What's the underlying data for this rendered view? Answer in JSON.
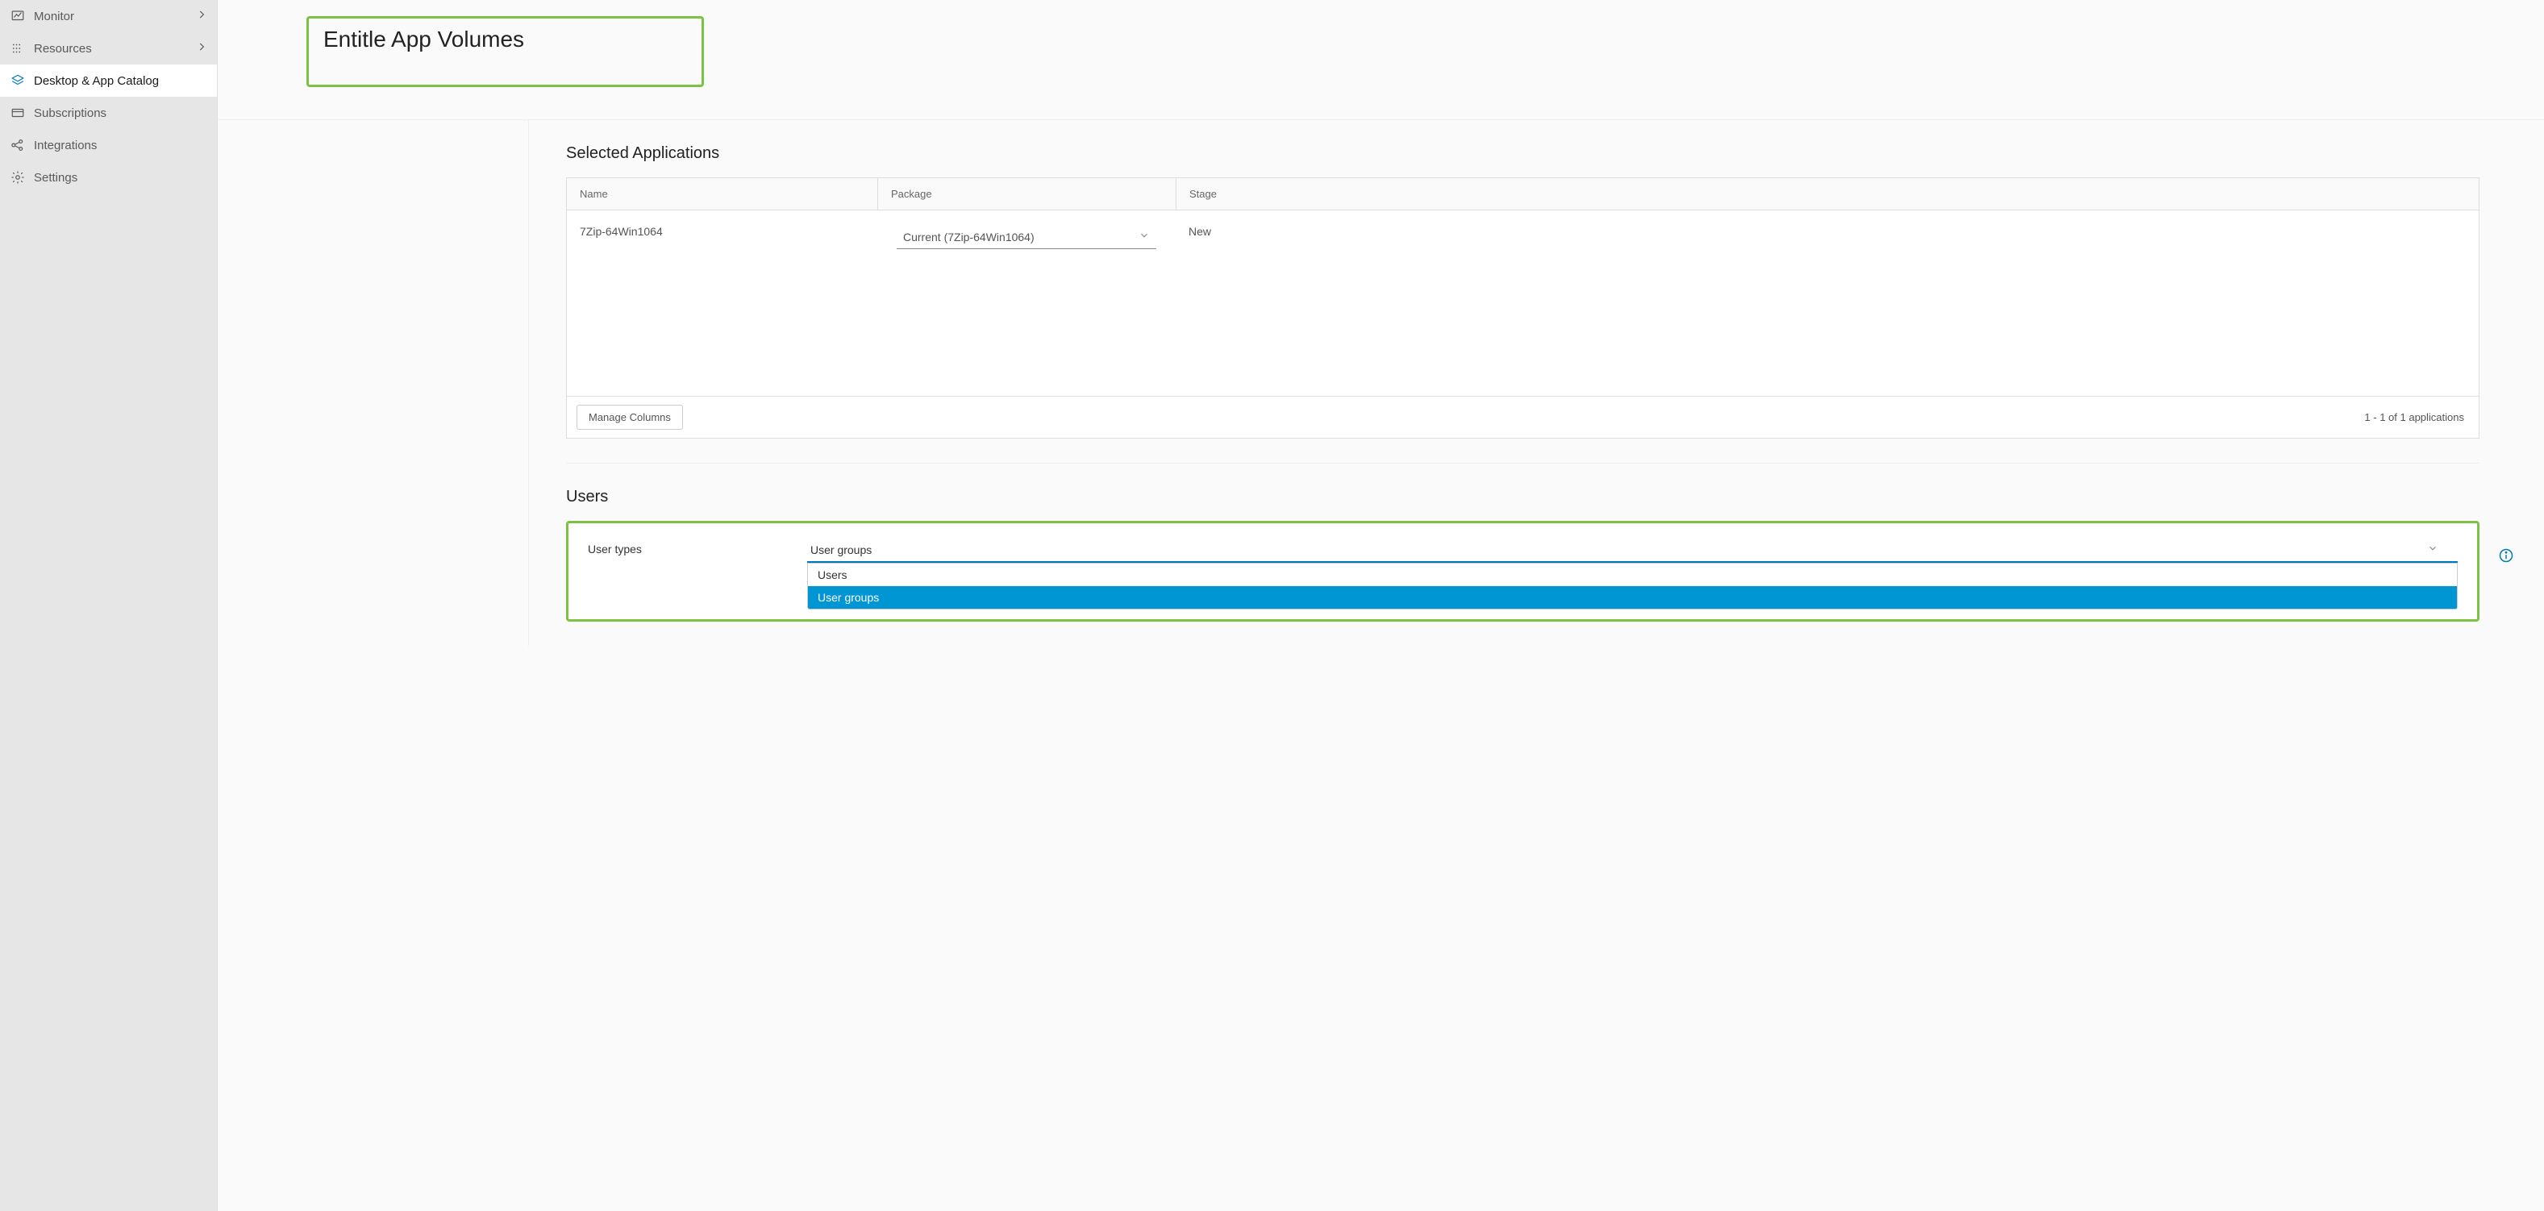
{
  "sidebar": {
    "items": [
      {
        "label": "Monitor",
        "icon": "chart-icon",
        "expandable": true
      },
      {
        "label": "Resources",
        "icon": "grid-icon",
        "expandable": true
      },
      {
        "label": "Desktop & App Catalog",
        "icon": "stack-icon",
        "active": true
      },
      {
        "label": "Subscriptions",
        "icon": "card-icon"
      },
      {
        "label": "Integrations",
        "icon": "nodes-icon"
      },
      {
        "label": "Settings",
        "icon": "gear-icon"
      }
    ]
  },
  "page": {
    "title": "Entitle App Volumes"
  },
  "selected_apps": {
    "heading": "Selected Applications",
    "columns": {
      "name": "Name",
      "package": "Package",
      "stage": "Stage"
    },
    "rows": [
      {
        "name": "7Zip-64Win1064",
        "package": "Current (7Zip-64Win1064)",
        "stage": "New"
      }
    ],
    "manage_columns_label": "Manage Columns",
    "count_text": "1 - 1 of 1 applications"
  },
  "users": {
    "heading": "Users",
    "type_label": "User types",
    "type_value": "User groups",
    "options": [
      {
        "label": "Users",
        "highlight": false
      },
      {
        "label": "User groups",
        "highlight": true
      }
    ]
  }
}
